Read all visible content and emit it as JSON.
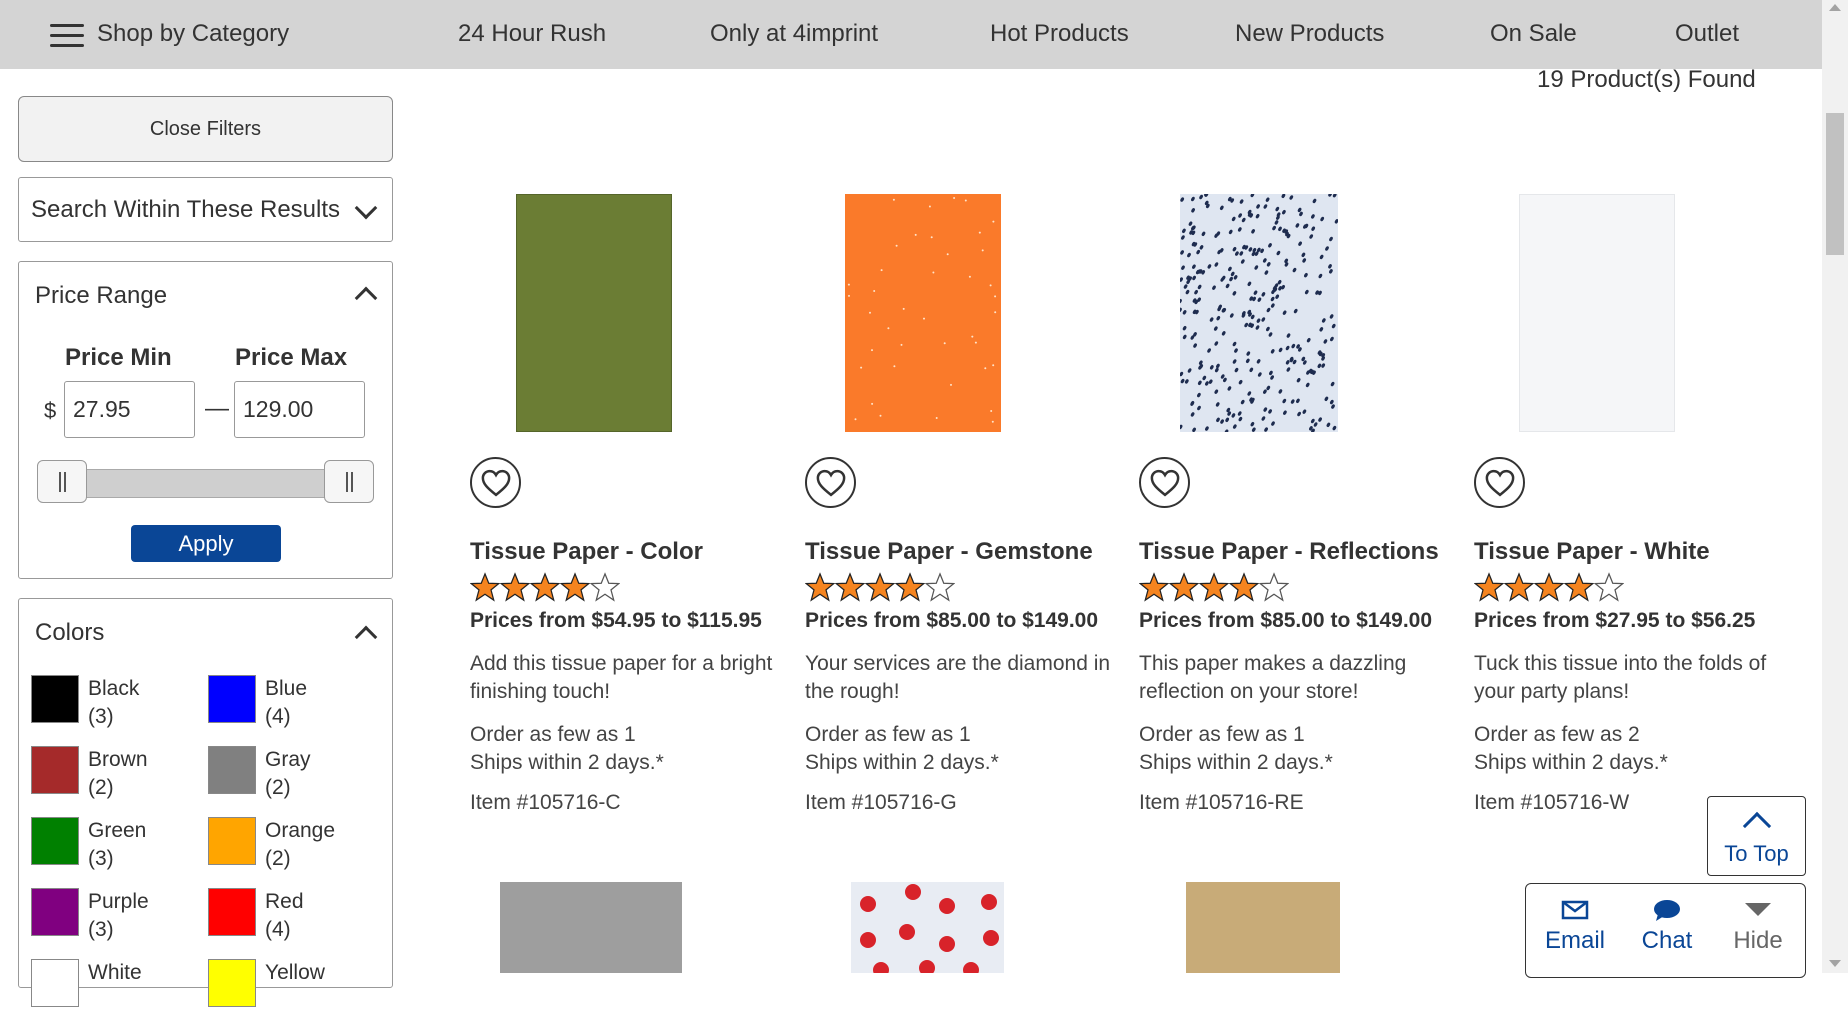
{
  "nav": {
    "menu_label": "Shop by Category",
    "items": [
      "24 Hour Rush",
      "Only at 4imprint",
      "Hot Products",
      "New Products",
      "On Sale",
      "Outlet"
    ]
  },
  "results": {
    "found_text": "19 Product(s) Found"
  },
  "filters": {
    "close_label": "Close Filters",
    "search_label": "Search Within These Results",
    "price": {
      "title": "Price Range",
      "min_label": "Price Min",
      "max_label": "Price Max",
      "currency": "$",
      "min_value": "27.95",
      "max_value": "129.00",
      "separator": "—",
      "apply_label": "Apply"
    },
    "colors": {
      "title": "Colors",
      "items": [
        {
          "name": "Black",
          "count": "(3)",
          "hex": "#000000"
        },
        {
          "name": "Blue",
          "count": "(4)",
          "hex": "#0000ff"
        },
        {
          "name": "Brown",
          "count": "(2)",
          "hex": "#a52a2a"
        },
        {
          "name": "Gray",
          "count": "(2)",
          "hex": "#808080"
        },
        {
          "name": "Green",
          "count": "(3)",
          "hex": "#008000"
        },
        {
          "name": "Orange",
          "count": "(2)",
          "hex": "#ffa500"
        },
        {
          "name": "Purple",
          "count": "(3)",
          "hex": "#800080"
        },
        {
          "name": "Red",
          "count": "(4)",
          "hex": "#ff0000"
        },
        {
          "name": "White",
          "count": "",
          "hex": "#ffffff"
        },
        {
          "name": "Yellow",
          "count": "",
          "hex": "#ffff00"
        }
      ]
    }
  },
  "products": [
    {
      "name": "Tissue Paper - Color",
      "rating": 4,
      "price": "Prices from $54.95 to $115.95",
      "desc": "Add this tissue paper for a bright finishing touch!",
      "order": "Order as few as 1",
      "ships": "Ships within 2 days.*",
      "item": "Item #105716-C",
      "image_color": "#6b7d34"
    },
    {
      "name": "Tissue Paper - Gemstone",
      "rating": 4,
      "price": "Prices from $85.00 to $149.00",
      "desc": "Your services are the diamond in the rough!",
      "order": "Order as few as 1",
      "ships": "Ships within 2 days.*",
      "item": "Item #105716-G",
      "image_color": "#fa7a2a"
    },
    {
      "name": "Tissue Paper - Reflections",
      "rating": 4,
      "price": "Prices from $85.00 to $149.00",
      "desc": "This paper makes a dazzling reflection on your store!",
      "order": "Order as few as 1",
      "ships": "Ships within 2 days.*",
      "item": "Item #105716-RE",
      "image_color": "#dfe6f1"
    },
    {
      "name": "Tissue Paper - White",
      "rating": 4,
      "price": "Prices from $27.95 to $56.25",
      "desc": "Tuck this tissue into the folds of your party plans!",
      "order": "Order as few as 2",
      "ships": "Ships within 2 days.*",
      "item": "Item #105716-W",
      "image_color": "#f5f6f8"
    }
  ],
  "next_row_images": [
    "#9e9e9e",
    "#e8ecf3",
    "#c8ab78"
  ],
  "widgets": {
    "to_top": "To Top",
    "email": "Email",
    "chat": "Chat",
    "hide": "Hide"
  },
  "colors": {
    "accent": "#0a4696",
    "nav_bg": "#d4d4d4",
    "star": "#f5841f"
  }
}
